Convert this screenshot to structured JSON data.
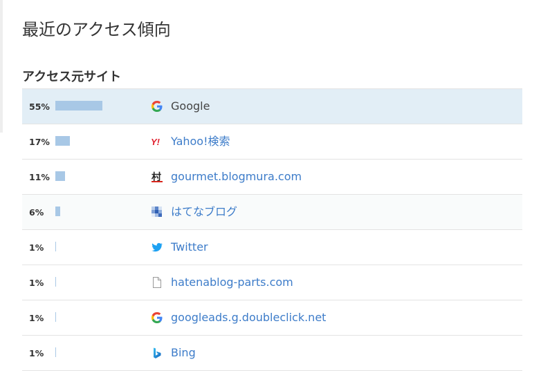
{
  "page_title": "最近のアクセス傾向",
  "section_title": "アクセス元サイト",
  "rows": [
    {
      "percent": "55%",
      "share": 55,
      "site": "Google",
      "icon": "google-icon"
    },
    {
      "percent": "17%",
      "share": 17,
      "site": "Yahoo!検索",
      "icon": "yahoo-icon"
    },
    {
      "percent": "11%",
      "share": 11,
      "site": "gourmet.blogmura.com",
      "icon": "blogmura-icon"
    },
    {
      "percent": "6%",
      "share": 6,
      "site": "はてなブログ",
      "icon": "hatena-blog-icon"
    },
    {
      "percent": "1%",
      "share": 1,
      "site": "Twitter",
      "icon": "twitter-bird-icon"
    },
    {
      "percent": "1%",
      "share": 1,
      "site": "hatenablog-parts.com",
      "icon": "document-icon"
    },
    {
      "percent": "1%",
      "share": 1,
      "site": "googleads.g.doubleclick.net",
      "icon": "google-icon"
    },
    {
      "percent": "1%",
      "share": 1,
      "site": "Bing",
      "icon": "bing-icon"
    }
  ],
  "colors": {
    "bar": "#a8c8e6",
    "link": "#3d7cc9",
    "highlight_row": "#e2eef6"
  }
}
